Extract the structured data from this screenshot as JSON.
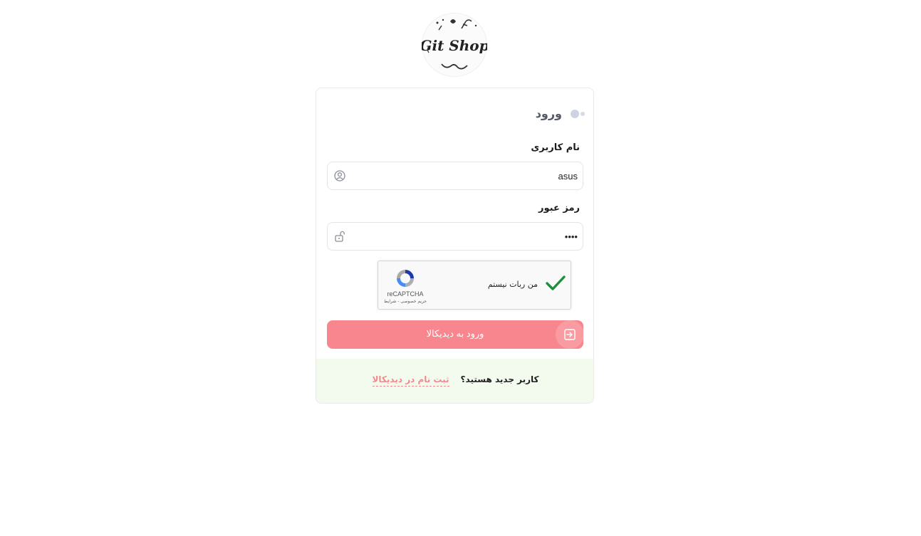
{
  "brand": {
    "logo_text": "Git Shop"
  },
  "login": {
    "title": "ورود",
    "username_label": "نام کاربری",
    "username_value": "asus",
    "password_label": "رمز عبور",
    "password_value": "••••",
    "submit_label": "ورود به دیدیکالا"
  },
  "captcha": {
    "checkbox_text": "من ربات نیستم",
    "checked": true,
    "brand": "reCAPTCHA",
    "links": "حریم خصوصی - شرایط"
  },
  "footer": {
    "question": "کاربر جدید هستید؟",
    "register_link": "ثبت نام در دیدیکالا"
  },
  "colors": {
    "primary": "#f7868e",
    "footer_bg": "#f3fbef",
    "check_green": "#1e8e3e"
  }
}
